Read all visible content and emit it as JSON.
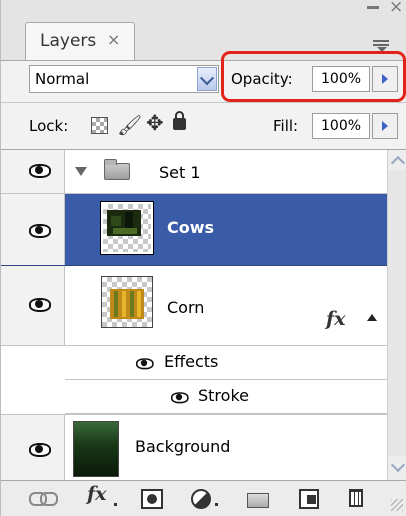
{
  "panel": {
    "tab_label": "Layers",
    "tab_close": "×",
    "window_close": "×"
  },
  "blend": {
    "mode": "Normal"
  },
  "opacity": {
    "label": "Opacity:",
    "value": "100%"
  },
  "lock": {
    "label": "Lock:"
  },
  "fill": {
    "label": "Fill:",
    "value": "100%"
  },
  "layers": [
    {
      "name": "Set 1",
      "type": "group",
      "visible": true
    },
    {
      "name": "Cows",
      "type": "layer",
      "selected": true,
      "visible": true
    },
    {
      "name": "Corn",
      "type": "layer",
      "visible": true,
      "has_effects": true,
      "fx_label": "fx"
    },
    {
      "name": "Effects",
      "type": "effects-group",
      "visible": true
    },
    {
      "name": "Stroke",
      "type": "effect",
      "visible": true
    },
    {
      "name": "Background",
      "type": "layer",
      "visible": true
    }
  ],
  "toolbar": {
    "fx_label": "fx"
  },
  "colors": {
    "selection": "#3a5ba8",
    "highlight_ring": "#e2231a",
    "arrow_blue": "#3b63c4"
  }
}
